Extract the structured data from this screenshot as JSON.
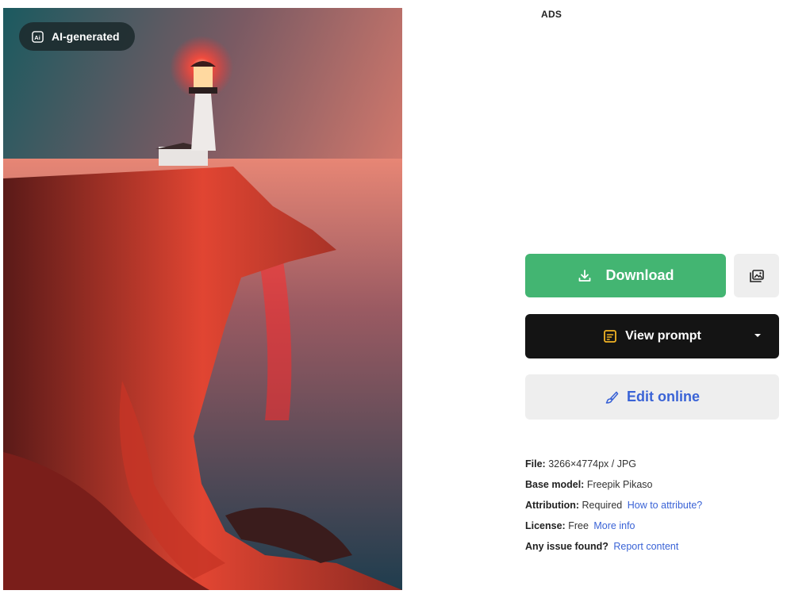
{
  "image": {
    "badge_label": "AI-generated",
    "badge_icon": "ai-sparkle-icon",
    "colors": {
      "sky_top": "#1f5a5e",
      "sky_glow": "#f08070",
      "cliff": "#d83a2a",
      "sea": "#2c4a5a"
    }
  },
  "ads": {
    "label": "ADS"
  },
  "actions": {
    "download_label": "Download",
    "download_icon": "download-icon",
    "collection_icon": "add-to-collection-icon",
    "view_prompt_label": "View prompt",
    "view_prompt_icon": "prompt-icon",
    "edit_online_label": "Edit online",
    "edit_online_icon": "brush-icon",
    "colors": {
      "download_bg": "#43b572",
      "prompt_bg": "#141414",
      "edit_text": "#3a63d6"
    }
  },
  "details": {
    "file_key": "File:",
    "file_value": "3266×4774px / JPG",
    "model_key": "Base model:",
    "model_value": "Freepik Pikaso",
    "attribution_key": "Attribution:",
    "attribution_value": "Required",
    "attribution_link": "How to attribute?",
    "license_key": "License:",
    "license_value": "Free",
    "license_link": "More info",
    "issue_key": "Any issue found?",
    "issue_link": "Report content"
  }
}
